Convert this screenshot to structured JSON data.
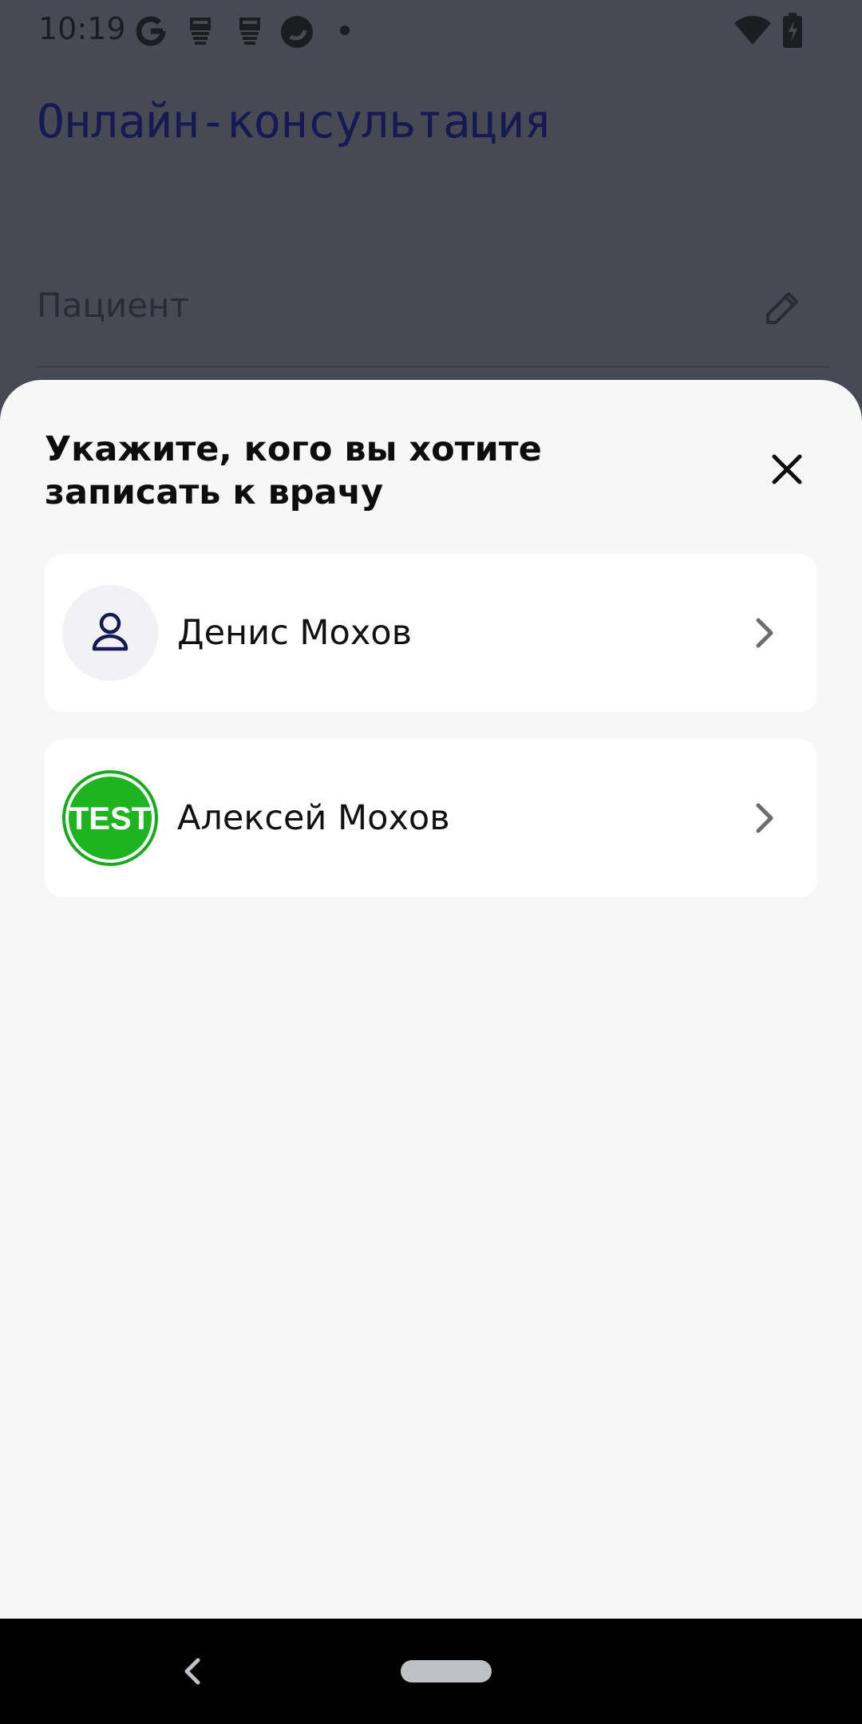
{
  "status_bar": {
    "time": "10:19",
    "icons": [
      "google-icon",
      "app-notification-icon",
      "app-notification-icon",
      "browser-icon",
      "more-dot-icon",
      "wifi-icon",
      "battery-charging-icon"
    ]
  },
  "background_screen": {
    "title": "Онлайн-консультация",
    "patient_label": "Пациент"
  },
  "sheet": {
    "title": "Укажите, кого вы хотите записать к врачу",
    "patients": [
      {
        "name": "Денис Мохов",
        "avatar": "person-icon"
      },
      {
        "name": "Алексей Мохов",
        "avatar": "test-avatar",
        "avatar_text": "TEST"
      }
    ]
  },
  "colors": {
    "accent": "#151a55",
    "test_avatar_green": "#1db41f",
    "sheet_bg": "#f7f7f7",
    "scrim": "#474a52"
  }
}
